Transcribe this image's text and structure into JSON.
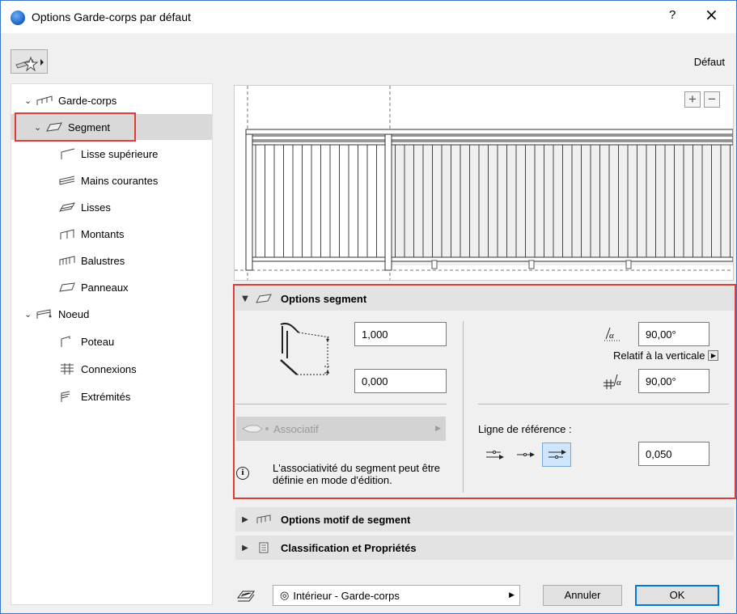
{
  "window": {
    "title": "Options Garde-corps par défaut",
    "help": "?",
    "close": "×"
  },
  "header": {
    "default_label": "Défaut"
  },
  "tree": {
    "root": "Garde-corps",
    "segment": "Segment",
    "lisse_sup": "Lisse supérieure",
    "mains": "Mains courantes",
    "lisses": "Lisses",
    "montants": "Montants",
    "balustres": "Balustres",
    "panneaux": "Panneaux",
    "noeud": "Noeud",
    "poteau": "Poteau",
    "connexions": "Connexions",
    "extremites": "Extrémités"
  },
  "preview": {
    "zoom_in": "+",
    "zoom_out": "−"
  },
  "options_segment": {
    "title": "Options segment",
    "height_value": "1,000",
    "offset_value": "0,000",
    "angle1_value": "90,00°",
    "relatif_label": "Relatif à la verticale",
    "angle2_value": "90,00°",
    "associatif_label": "Associatif",
    "info_text": "L'associativité du segment peut être définie en mode d'édition.",
    "ref_line_label": "Ligne de référence :",
    "ref_offset_value": "0,050"
  },
  "panels": {
    "motif_title": "Options motif de segment",
    "classification_title": "Classification et Propriétés"
  },
  "footer": {
    "layer_value": "Intérieur - Garde-corps",
    "cancel_label": "Annuler",
    "ok_label": "OK"
  },
  "colors": {
    "highlight": "#e53935",
    "selection": "#d9d9d9",
    "accent": "#0078d7"
  }
}
